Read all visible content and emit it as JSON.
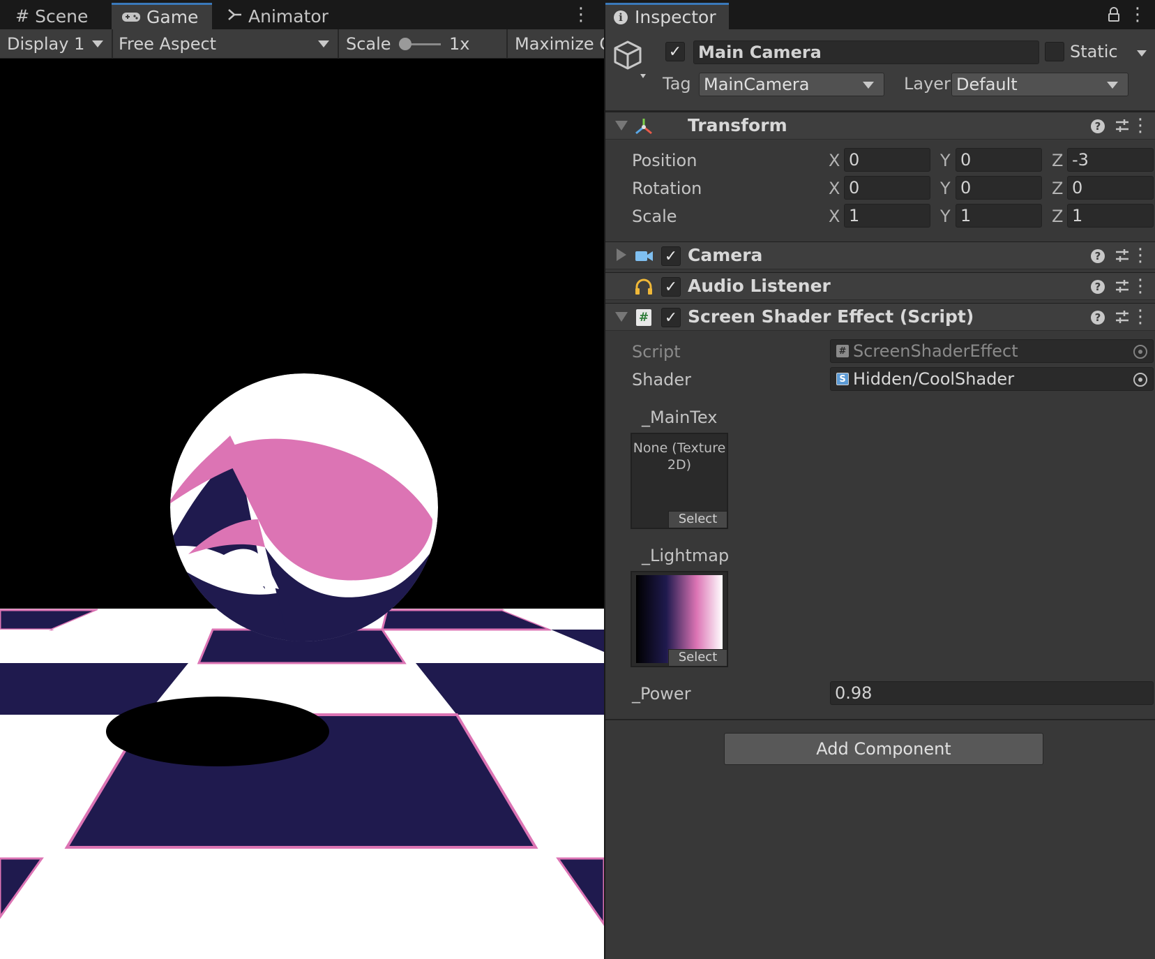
{
  "game_view": {
    "tabs": [
      {
        "label": "Scene",
        "icon": "grid-icon"
      },
      {
        "label": "Game",
        "icon": "gamepad-icon"
      },
      {
        "label": "Animator",
        "icon": "animator-icon"
      }
    ],
    "toolbar": {
      "display": "Display 1",
      "aspect": "Free Aspect",
      "scale_label": "Scale",
      "scale_value": "1x",
      "maximize": "Maximize O"
    }
  },
  "inspector": {
    "tab_label": "Inspector",
    "object": {
      "active": true,
      "name": "Main Camera",
      "static_label": "Static",
      "tag_label": "Tag",
      "tag_value": "MainCamera",
      "layer_label": "Layer",
      "layer_value": "Default"
    },
    "transform": {
      "title": "Transform",
      "rows": [
        {
          "label": "Position",
          "x": "0",
          "y": "0",
          "z": "-3"
        },
        {
          "label": "Rotation",
          "x": "0",
          "y": "0",
          "z": "0"
        },
        {
          "label": "Scale",
          "x": "1",
          "y": "1",
          "z": "1"
        }
      ],
      "axes": {
        "x": "X",
        "y": "Y",
        "z": "Z"
      }
    },
    "camera": {
      "title": "Camera"
    },
    "audio_listener": {
      "title": "Audio Listener"
    },
    "screen_shader": {
      "title": "Screen Shader Effect (Script)",
      "script_label": "Script",
      "script_value": "ScreenShaderEffect",
      "shader_label": "Shader",
      "shader_value": "Hidden/CoolShader",
      "maintex_label": "_MainTex",
      "maintex_none": "None (Texture 2D)",
      "select_label": "Select",
      "lightmap_label": "_Lightmap",
      "power_label": "_Power",
      "power_value": "0.98"
    },
    "add_component": "Add Component"
  },
  "colors": {
    "navy": "#1f1a4e",
    "pink": "#dc74b4",
    "white": "#ffffff",
    "accent_tab": "#3a79bb"
  }
}
